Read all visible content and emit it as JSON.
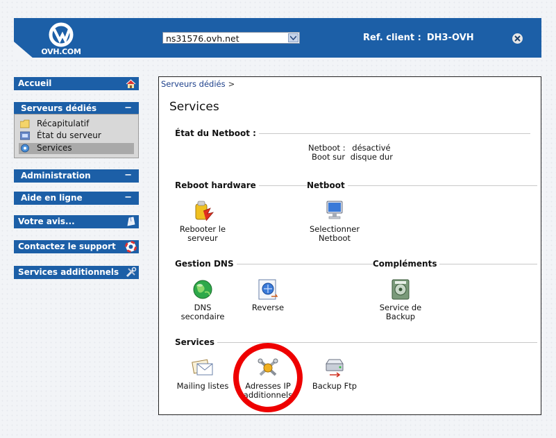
{
  "header": {
    "logo_text": "OVH.COM",
    "server_select_value": "ns31576.ovh.net",
    "ref_label": "Ref. client :",
    "ref_value": "DH3-OVH"
  },
  "sidebar": {
    "accueil": "Accueil",
    "serveurs_dedies": "Serveurs dédiés",
    "sub_items": [
      "Récapitulatif",
      "État du serveur",
      "Services"
    ],
    "administration": "Administration",
    "aide": "Aide en ligne",
    "avis": "Votre avis...",
    "support": "Contactez le support",
    "additionnels": "Services additionnels",
    "collapse_symbol": "−"
  },
  "content": {
    "breadcrumb": "Serveurs dédiés",
    "breadcrumb_sep": ">",
    "title": "Services",
    "netboot_state_title": "État du Netboot :",
    "netboot_label": "Netboot :",
    "netboot_value": "désactivé",
    "boot_label": "Boot sur",
    "boot_value": "disque dur",
    "reboot_hardware": "Reboot hardware",
    "netboot": "Netboot",
    "reboot_btn": [
      "Rebooter le",
      "serveur"
    ],
    "netboot_btn": [
      "Selectionner",
      "Netboot"
    ],
    "gestion_dns": "Gestion DNS",
    "complements": "Compléments",
    "dns_btn": [
      "DNS",
      "secondaire"
    ],
    "reverse_btn": "Reverse",
    "backup_btn": [
      "Service de",
      "Backup"
    ],
    "services": "Services",
    "mailing_btn": "Mailing listes",
    "ip_btn": [
      "Adresses IP",
      "additionnels"
    ],
    "ftp_btn": "Backup Ftp"
  },
  "colors": {
    "brand_blue": "#1c5fa7",
    "highlight_red": "#ee0000"
  }
}
